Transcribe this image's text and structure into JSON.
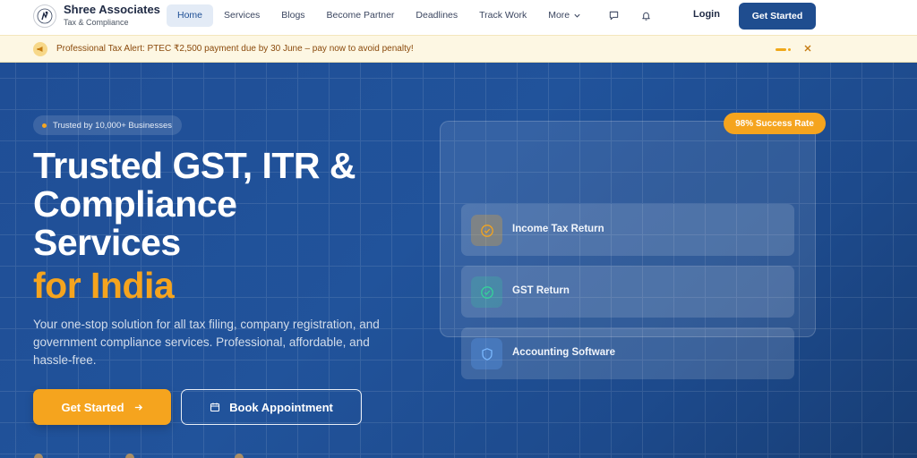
{
  "brand": {
    "name": "Shree Associates",
    "tagline": "Tax & Compliance"
  },
  "nav": {
    "links": [
      {
        "label": "Home",
        "active": true
      },
      {
        "label": "Services"
      },
      {
        "label": "Blogs"
      },
      {
        "label": "Become Partner"
      },
      {
        "label": "Deadlines"
      },
      {
        "label": "Track Work"
      },
      {
        "label": "More"
      }
    ],
    "icons": [
      "chat-icon",
      "bell-icon"
    ],
    "login_label": "Login",
    "cta_label": "Get Started"
  },
  "alert": {
    "text": "Professional Tax Alert: PTEC ₹2,500 payment due by 30 June – pay now to avoid penalty!",
    "icon": "megaphone-icon"
  },
  "hero": {
    "badge": "Trusted by 10,000+ Businesses",
    "title_lines": [
      "Trusted GST, ITR &",
      "Compliance",
      "Services"
    ],
    "title_accent": "for India",
    "description": "Your one-stop solution for all tax filing, company registration, and government compliance services. Professional, affordable, and hassle-free.",
    "primary_button": "Get Started",
    "secondary_button": "Book Appointment"
  },
  "service_card": {
    "badge": "98% Success Rate",
    "items": [
      {
        "label": "Income Tax Return",
        "icon": "check-circle-icon",
        "color": "#f5a41e"
      },
      {
        "label": "GST Return",
        "icon": "check-circle-icon",
        "color": "#34d399"
      },
      {
        "label": "Accounting Software",
        "icon": "shield-icon",
        "color": "#60a5fa"
      }
    ]
  },
  "colors": {
    "primary": "#1f4d8f",
    "accent": "#f5a41e",
    "hero_bg": "#21539b",
    "alert_bg": "#fdf7e3",
    "alert_text": "#8a4a0c"
  }
}
